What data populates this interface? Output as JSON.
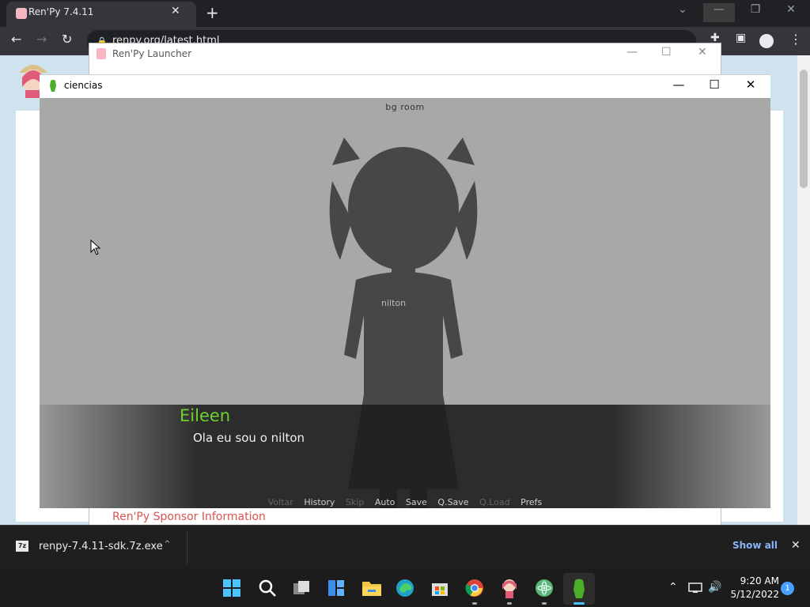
{
  "browser": {
    "tab_title": "Ren'Py 7.4.11",
    "url": "renpy.org/latest.html"
  },
  "launcher": {
    "title": "Ren'Py Launcher",
    "sponsor_link": "Ren'Py Sponsor Information"
  },
  "game": {
    "window_title": "ciencias",
    "bg_label": "bg room",
    "character_label": "nilton",
    "speaker": "Eileen",
    "dialogue": "Ola eu sou o nilton",
    "menu": {
      "voltar": "Voltar",
      "history": "History",
      "skip": "Skip",
      "auto": "Auto",
      "save": "Save",
      "qsave": "Q.Save",
      "qload": "Q.Load",
      "prefs": "Prefs"
    }
  },
  "download": {
    "file_name": "renpy-7.4.11-sdk.7z.exe",
    "show_all": "Show all",
    "badge": "7z"
  },
  "taskbar": {
    "time": "9:20 AM",
    "date": "5/12/2022",
    "notifications": "1"
  },
  "colors": {
    "speaker": "#6fd12c",
    "sponsor_link": "#d9534f",
    "show_all": "#8ab4f8"
  }
}
